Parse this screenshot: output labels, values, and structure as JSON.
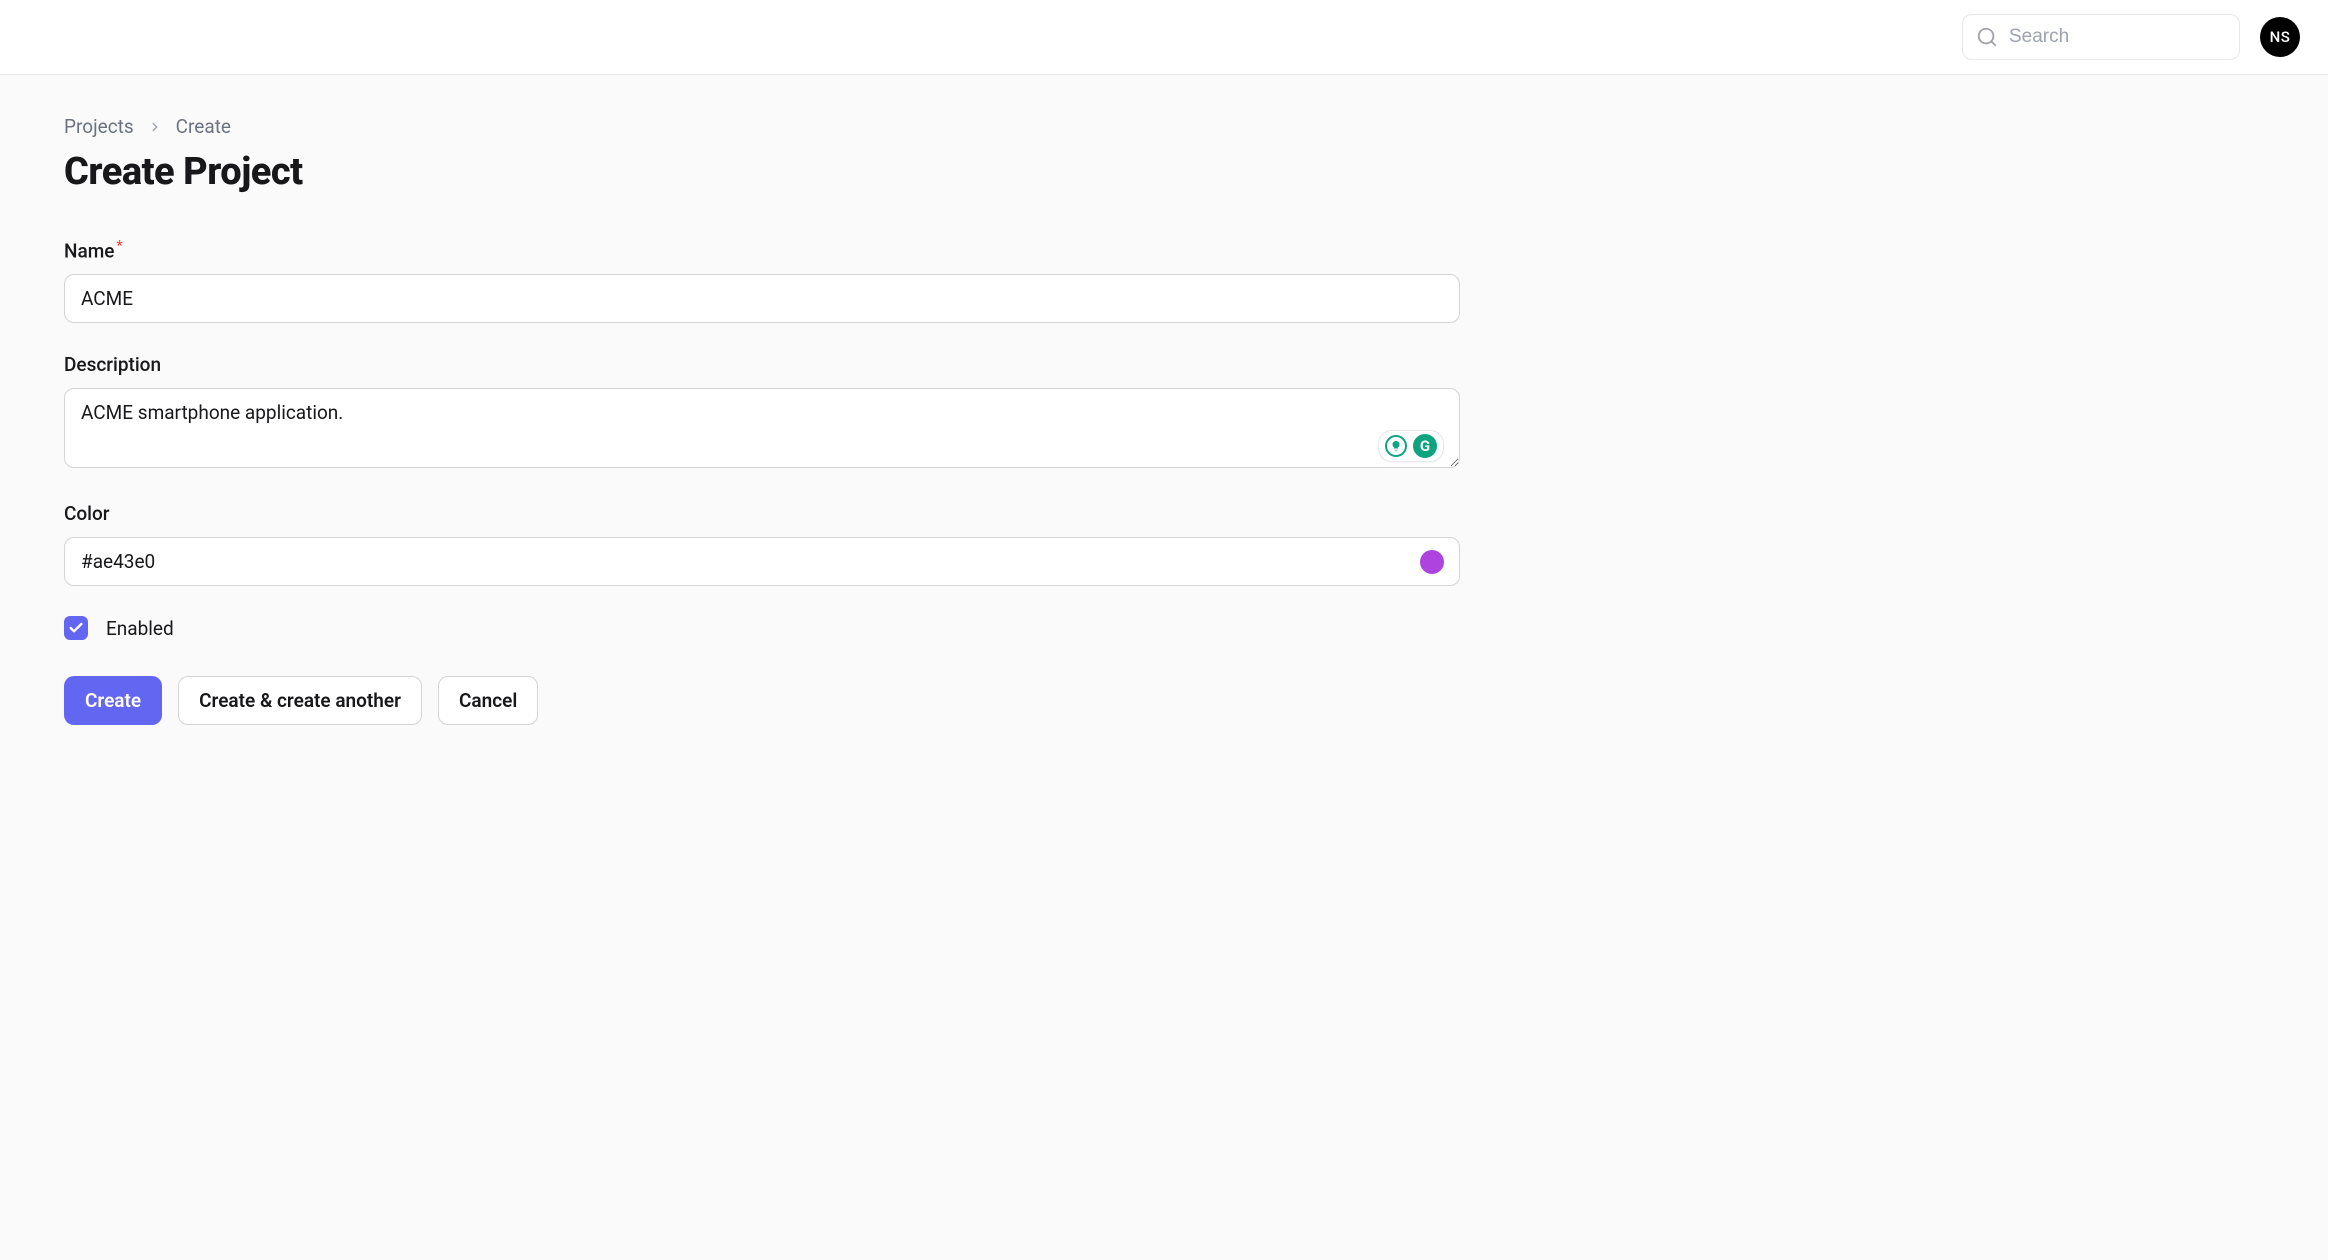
{
  "header": {
    "search_placeholder": "Search",
    "avatar_initials": "NS"
  },
  "breadcrumb": {
    "parent": "Projects",
    "current": "Create"
  },
  "page": {
    "title": "Create Project"
  },
  "form": {
    "name": {
      "label": "Name",
      "value": "ACME"
    },
    "description": {
      "label": "Description",
      "value": "ACME smartphone application."
    },
    "color": {
      "label": "Color",
      "value": "#ae43e0",
      "swatch": "#ae43e0"
    },
    "enabled": {
      "label": "Enabled",
      "checked": true
    }
  },
  "buttons": {
    "create": "Create",
    "create_another": "Create & create another",
    "cancel": "Cancel"
  }
}
